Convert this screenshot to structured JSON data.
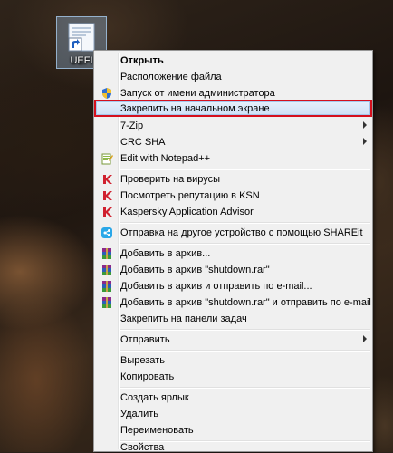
{
  "desktop": {
    "icon_label": "UEFI",
    "icon_name": "shortcut-file-icon"
  },
  "highlight_color": "#d5101e",
  "menu": {
    "items": [
      {
        "label": "Открыть",
        "bold": true,
        "icon": ""
      },
      {
        "label": "Расположение файла",
        "icon": ""
      },
      {
        "label": "Запуск от имени администратора",
        "icon": "uac-shield-icon"
      },
      {
        "label": "Закрепить на начальном экране",
        "icon": "",
        "highlighted": true
      },
      {
        "label": "7-Zip",
        "icon": "",
        "submenu": true
      },
      {
        "label": "CRC SHA",
        "icon": "",
        "submenu": true
      },
      {
        "label": "Edit with Notepad++",
        "icon": "notepad-plus-plus-icon"
      },
      {
        "label": "Проверить на вирусы",
        "icon": "kaspersky-icon"
      },
      {
        "label": "Посмотреть репутацию в KSN",
        "icon": "kaspersky-icon"
      },
      {
        "label": "Kaspersky Application Advisor",
        "icon": "kaspersky-icon"
      },
      {
        "label": "Отправка на другое устройство с помощью SHAREit",
        "icon": "shareit-icon"
      },
      {
        "label": "Добавить в архив...",
        "icon": "winrar-icon"
      },
      {
        "label": "Добавить в архив \"shutdown.rar\"",
        "icon": "winrar-icon"
      },
      {
        "label": "Добавить в архив и отправить по e-mail...",
        "icon": "winrar-icon"
      },
      {
        "label": "Добавить в архив \"shutdown.rar\" и отправить по e-mail",
        "icon": "winrar-icon"
      },
      {
        "label": "Закрепить на панели задач",
        "icon": ""
      },
      {
        "label": "Отправить",
        "icon": "",
        "submenu": true
      },
      {
        "label": "Вырезать",
        "icon": ""
      },
      {
        "label": "Копировать",
        "icon": ""
      },
      {
        "label": "Создать ярлык",
        "icon": ""
      },
      {
        "label": "Удалить",
        "icon": ""
      },
      {
        "label": "Переименовать",
        "icon": ""
      },
      {
        "label": "Свойства",
        "icon": ""
      }
    ]
  }
}
